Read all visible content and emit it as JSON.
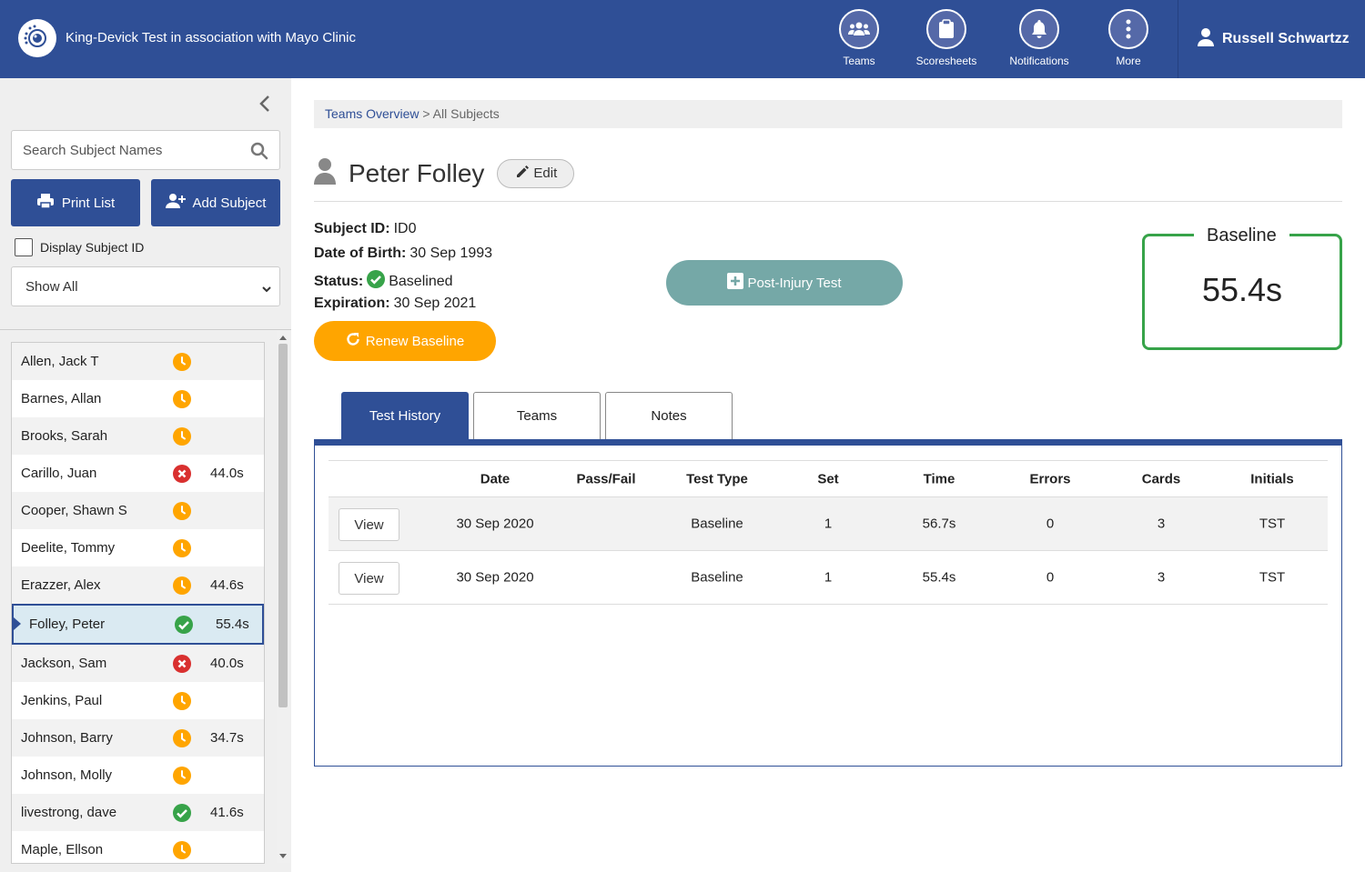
{
  "header": {
    "title": "King-Devick Test in association with Mayo Clinic",
    "nav": [
      {
        "label": "Teams",
        "icon": "teams-icon"
      },
      {
        "label": "Scoresheets",
        "icon": "clipboard-icon"
      },
      {
        "label": "Notifications",
        "icon": "bell-icon"
      },
      {
        "label": "More",
        "icon": "more-vertical-icon"
      }
    ],
    "user": "Russell Schwartzz"
  },
  "sidebar": {
    "search_placeholder": "Search Subject Names",
    "print_label": "Print List",
    "add_label": "Add Subject",
    "display_id_label": "Display Subject ID",
    "filter_value": "Show All",
    "subjects": [
      {
        "name": "Allen, Jack T",
        "status": "pending",
        "time": ""
      },
      {
        "name": "Barnes, Allan",
        "status": "pending",
        "time": ""
      },
      {
        "name": "Brooks, Sarah",
        "status": "pending",
        "time": ""
      },
      {
        "name": "Carillo, Juan",
        "status": "failed",
        "time": "44.0s"
      },
      {
        "name": "Cooper, Shawn S",
        "status": "pending",
        "time": ""
      },
      {
        "name": "Deelite, Tommy",
        "status": "pending",
        "time": ""
      },
      {
        "name": "Erazzer, Alex",
        "status": "pending",
        "time": "44.6s"
      },
      {
        "name": "Folley, Peter",
        "status": "ok",
        "time": "55.4s",
        "selected": true
      },
      {
        "name": "Jackson, Sam",
        "status": "failed",
        "time": "40.0s"
      },
      {
        "name": "Jenkins, Paul",
        "status": "pending",
        "time": ""
      },
      {
        "name": "Johnson, Barry",
        "status": "pending",
        "time": "34.7s"
      },
      {
        "name": "Johnson, Molly",
        "status": "pending",
        "time": ""
      },
      {
        "name": "livestrong, dave",
        "status": "ok",
        "time": "41.6s"
      },
      {
        "name": "Maple, Ellson",
        "status": "pending",
        "time": ""
      }
    ]
  },
  "breadcrumb": {
    "link": "Teams Overview",
    "separator": " > ",
    "current": "All Subjects"
  },
  "subject": {
    "name": "Peter Folley",
    "edit_label": "Edit",
    "id_label": "Subject ID:",
    "id_value": "ID0",
    "dob_label": "Date of Birth:",
    "dob_value": "30 Sep 1993",
    "status_label": "Status:",
    "status_value": "Baselined",
    "exp_label": "Expiration:",
    "exp_value": "30 Sep 2021"
  },
  "actions": {
    "renew_label": "Renew Baseline",
    "post_injury_label": "Post-Injury Test"
  },
  "baseline": {
    "title": "Baseline",
    "value": "55.4s"
  },
  "tabs": [
    "Test History",
    "Teams",
    "Notes"
  ],
  "history": {
    "columns": [
      "Date",
      "Pass/Fail",
      "Test Type",
      "Set",
      "Time",
      "Errors",
      "Cards",
      "Initials"
    ],
    "view_label": "View",
    "rows": [
      {
        "date": "30 Sep 2020",
        "passfail": "",
        "type": "Baseline",
        "set": "1",
        "time": "56.7s",
        "errors": "0",
        "cards": "3",
        "initials": "TST"
      },
      {
        "date": "30 Sep 2020",
        "passfail": "",
        "type": "Baseline",
        "set": "1",
        "time": "55.4s",
        "errors": "0",
        "cards": "3",
        "initials": "TST"
      }
    ]
  },
  "colors": {
    "brand": "#2f4f96",
    "orange": "#ffa500",
    "green": "#37a349",
    "red": "#d9302f",
    "teal": "#75a8a7"
  }
}
